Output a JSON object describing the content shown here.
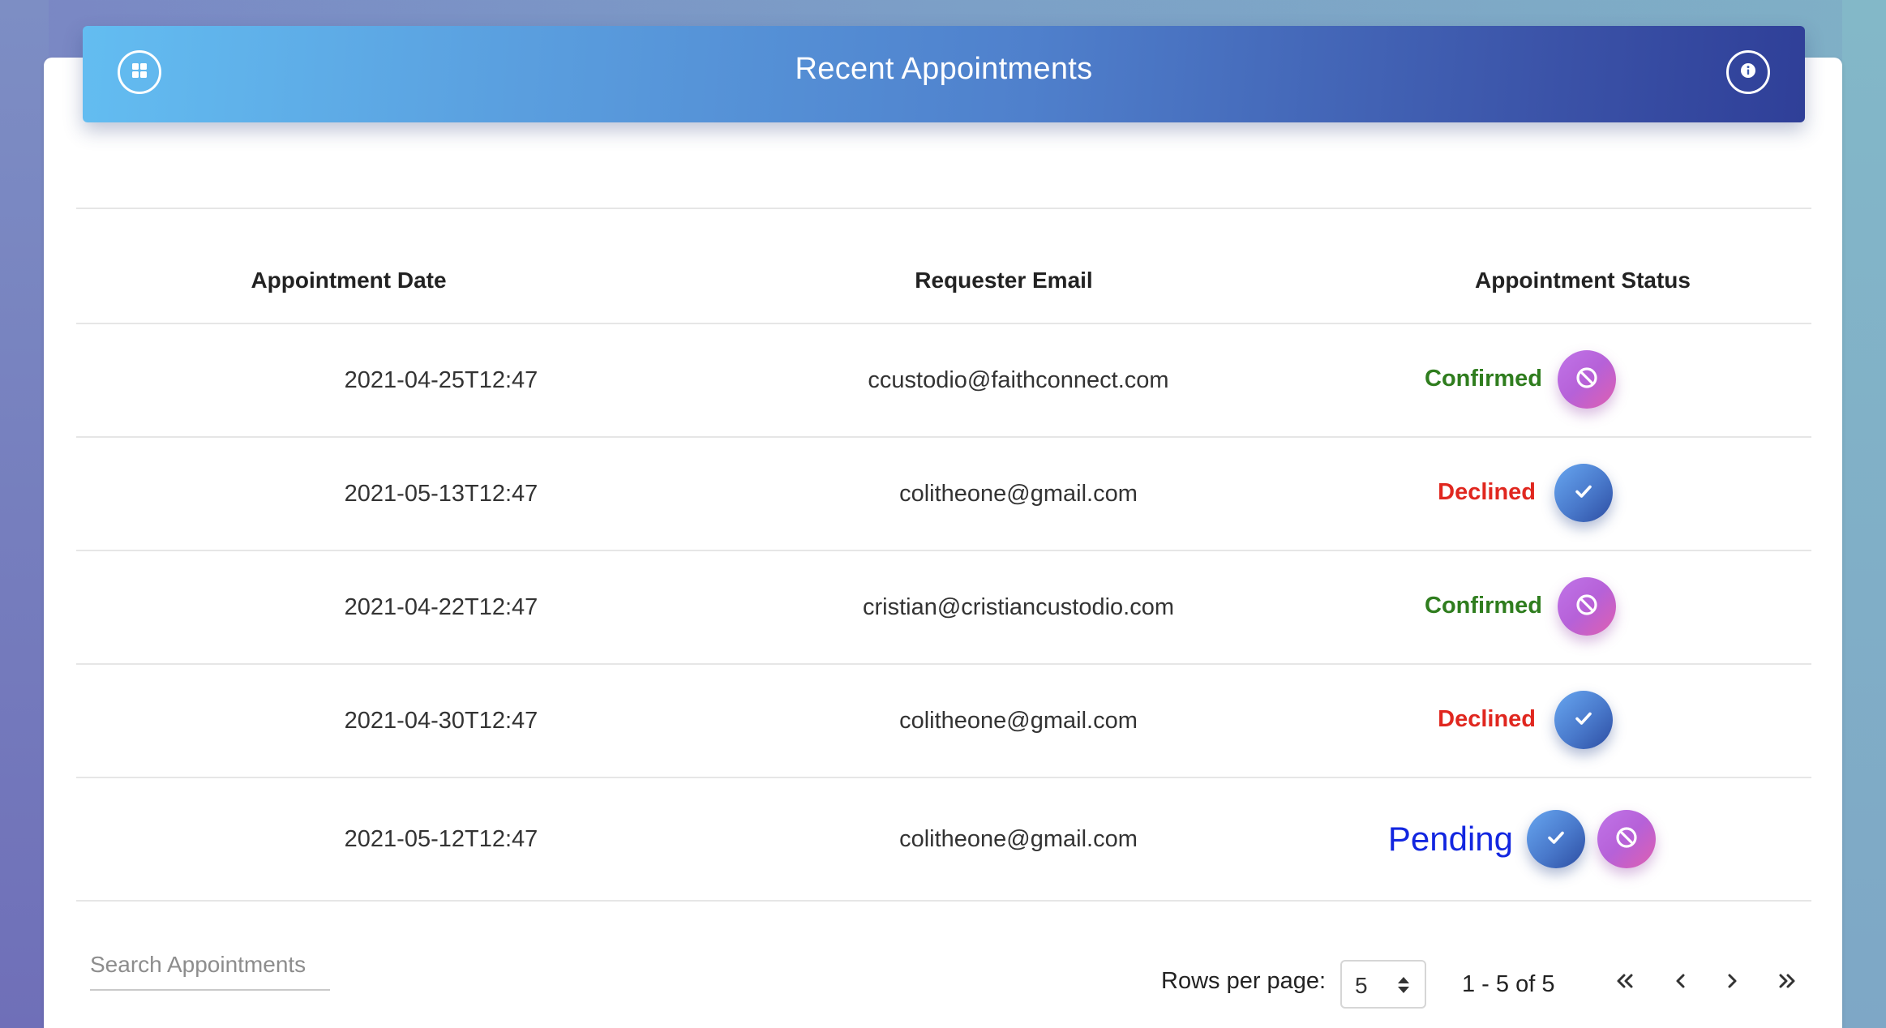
{
  "header": {
    "title": "Recent Appointments",
    "left_icon": "dashboard-icon",
    "right_icon": "info-icon"
  },
  "table": {
    "columns": [
      "Appointment Date",
      "Requester Email",
      "Appointment Status"
    ],
    "rows": [
      {
        "date": "2021-04-25T12:47",
        "email": "ccustodio@faithconnect.com",
        "status": "Confirmed",
        "actions": [
          "decline"
        ]
      },
      {
        "date": "2021-05-13T12:47",
        "email": "colitheone@gmail.com",
        "status": "Declined",
        "actions": [
          "accept"
        ]
      },
      {
        "date": "2021-04-22T12:47",
        "email": "cristian@cristiancustodio.com",
        "status": "Confirmed",
        "actions": [
          "decline"
        ]
      },
      {
        "date": "2021-04-30T12:47",
        "email": "colitheone@gmail.com",
        "status": "Declined",
        "actions": [
          "accept"
        ]
      },
      {
        "date": "2021-05-12T12:47",
        "email": "colitheone@gmail.com",
        "status": "Pending",
        "actions": [
          "accept",
          "decline"
        ]
      }
    ]
  },
  "footer": {
    "search_placeholder": "Search Appointments",
    "rows_per_page_label": "Rows per page:",
    "rows_per_page_value": "5",
    "range_text": "1 - 5 of 5"
  },
  "colors": {
    "confirmed": "#2f7d1e",
    "declined": "#e0271f",
    "pending": "#1226e0",
    "header_start": "#63bdf1",
    "header_end": "#2f3f98"
  }
}
